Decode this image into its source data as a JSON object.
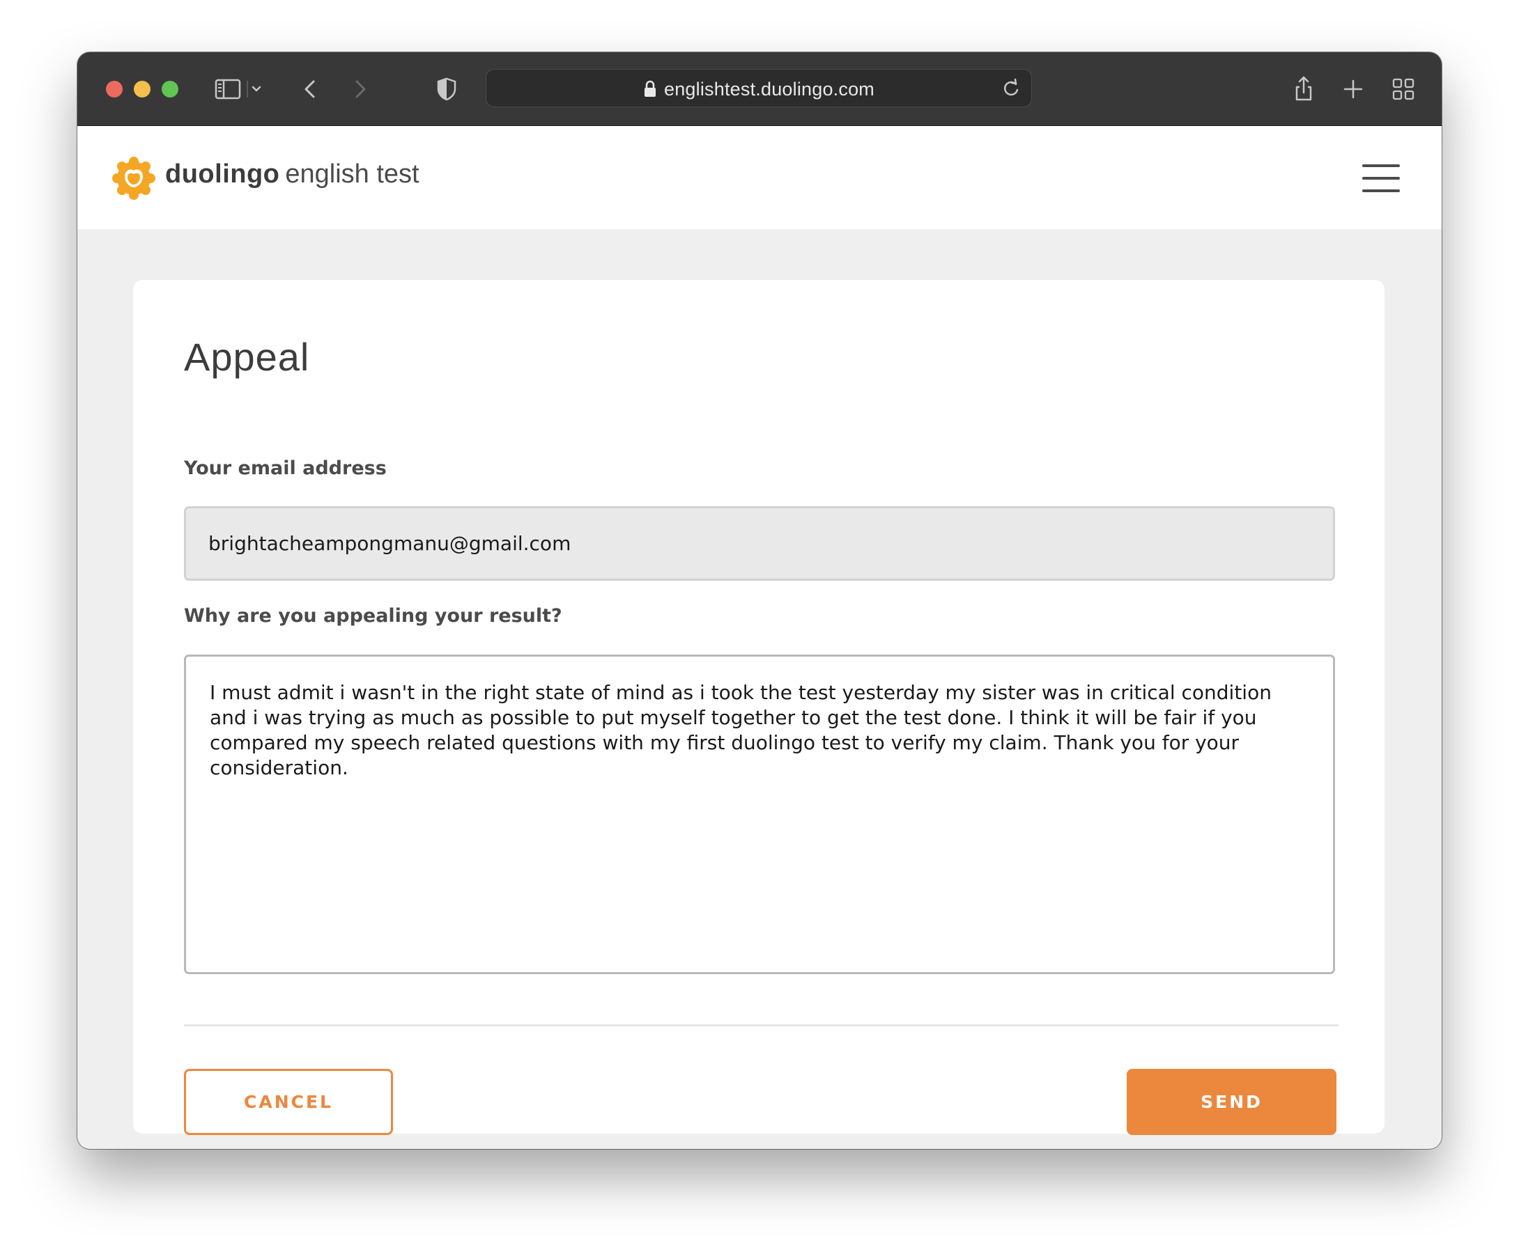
{
  "browser": {
    "url": "englishtest.duolingo.com"
  },
  "header": {
    "brand_bold": "duolingo",
    "brand_light": "english test"
  },
  "form": {
    "title": "Appeal",
    "email_label": "Your email address",
    "email_value": "brightacheampongmanu@gmail.com",
    "reason_label": "Why are you appealing your result?",
    "reason_value": "I must admit i wasn't in the right state of mind as i took the test yesterday my sister was in critical condition and i was trying as much as possible to put myself together to get the test done. I think it will be fair if you compared my speech related questions with my first duolingo test to verify my claim. Thank you for your consideration."
  },
  "actions": {
    "cancel_label": "CANCEL",
    "send_label": "SEND"
  },
  "colors": {
    "accent": "#ec883d",
    "logo": "#f5a623",
    "toolbar": "#383838",
    "page_bg": "#efefef"
  },
  "icons": {
    "toolbar": [
      "sidebar-icon",
      "chevron-down-icon",
      "back-arrow-icon",
      "forward-arrow-icon",
      "shield-icon",
      "lock-icon",
      "reload-icon",
      "share-icon",
      "new-tab-plus-icon",
      "tab-overview-icon"
    ],
    "header": [
      "duolingo-logo-icon",
      "hamburger-menu-icon"
    ]
  }
}
